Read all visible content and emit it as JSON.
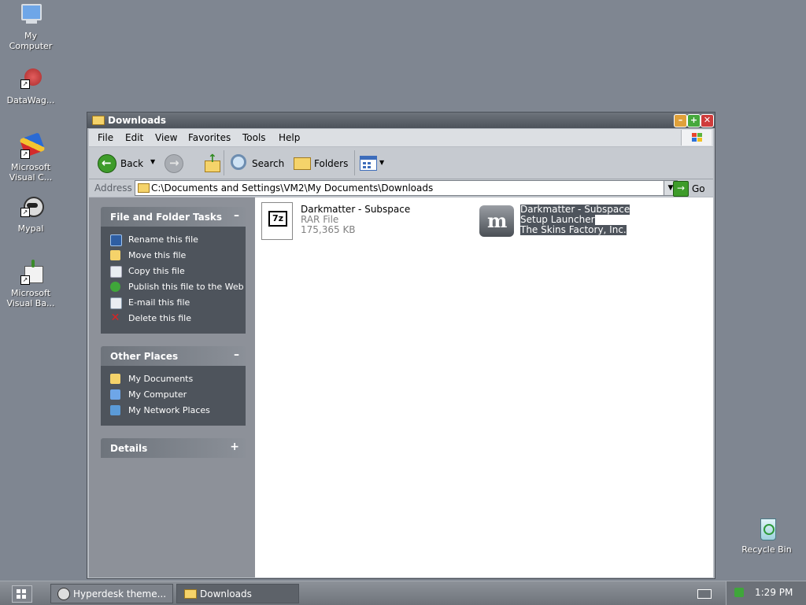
{
  "desktop": {
    "icons": [
      {
        "label": "My\nComputer",
        "icon": "my-computer-icon"
      },
      {
        "label": "DataWag...",
        "icon": "datawag-icon"
      },
      {
        "label": "Microsoft\nVisual C...",
        "icon": "visual-c-icon"
      },
      {
        "label": "Mypal",
        "icon": "mypal-icon"
      },
      {
        "label": "Microsoft\nVisual Ba...",
        "icon": "visual-basic-icon"
      },
      {
        "label": "Recycle Bin",
        "icon": "recycle-bin-icon"
      }
    ]
  },
  "window": {
    "title": "Downloads",
    "menu": [
      "File",
      "Edit",
      "View",
      "Favorites",
      "Tools",
      "Help"
    ],
    "toolbar": {
      "back": "Back",
      "search": "Search",
      "folders": "Folders"
    },
    "address": {
      "label": "Address",
      "value": "C:\\Documents and Settings\\VM2\\My Documents\\Downloads",
      "go": "Go"
    }
  },
  "taskpane": {
    "file_tasks": {
      "title": "File and Folder Tasks",
      "items": [
        "Rename this file",
        "Move this file",
        "Copy this file",
        "Publish this file to the Web",
        "E-mail this file",
        "Delete this file"
      ]
    },
    "other_places": {
      "title": "Other Places",
      "items": [
        "My Documents",
        "My Computer",
        "My Network Places"
      ]
    },
    "details": {
      "title": "Details"
    }
  },
  "files": [
    {
      "name": "Darkmatter - Subspace",
      "line2": "RAR File",
      "line3": "175,365 KB",
      "icon_text": "7z"
    },
    {
      "name": "Darkmatter - Subspace",
      "line2": "Setup Launcher",
      "line3": "The Skins Factory, Inc.",
      "icon_text": "m"
    }
  ],
  "taskbar": {
    "items": [
      "Hyperdesk theme...",
      "Downloads"
    ],
    "clock": "1:29 PM"
  },
  "colors": {
    "desktop": "#7f8691",
    "panel_dark": "#4e545c",
    "selection": "#4e545c"
  }
}
